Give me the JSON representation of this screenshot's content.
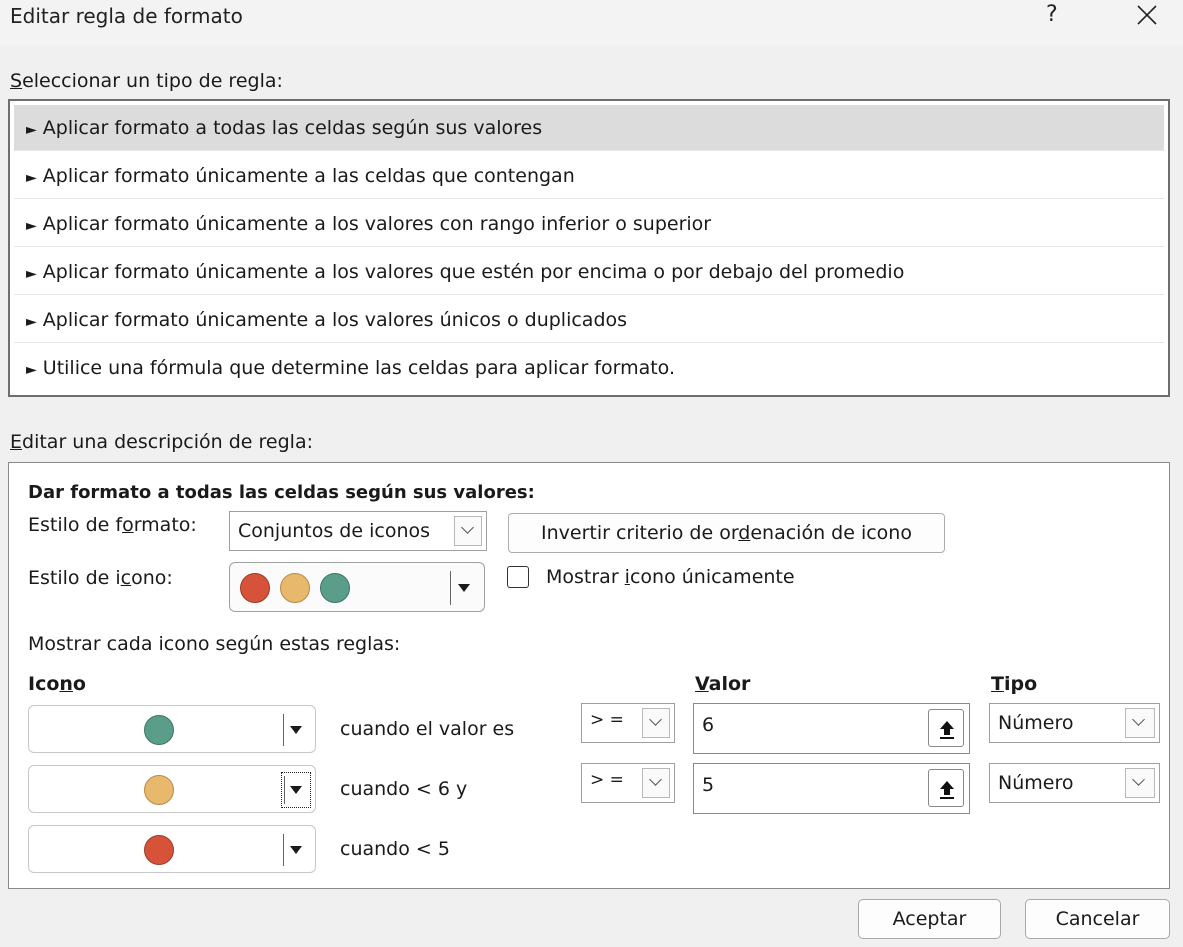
{
  "window": {
    "title": "Editar regla de formato",
    "help_label": "?"
  },
  "rule_type": {
    "label_accel": "S",
    "label_rest": "eleccionar un tipo de regla:",
    "items": [
      {
        "label": "Aplicar formato a todas las celdas según sus valores"
      },
      {
        "label": "Aplicar formato únicamente a las celdas que contengan"
      },
      {
        "label": "Aplicar formato únicamente a los valores con rango inferior o superior"
      },
      {
        "label": "Aplicar formato únicamente a los valores que estén por encima o por debajo del promedio"
      },
      {
        "label": "Aplicar formato únicamente a los valores únicos o duplicados"
      },
      {
        "label": "Utilice una fórmula que determine las celdas para aplicar formato."
      }
    ],
    "selected_index": 0,
    "arrow_glyph": "►"
  },
  "description": {
    "label_accel": "E",
    "label_rest": "ditar una descripción de regla:",
    "heading": "Dar formato a todas las celdas según sus valores:",
    "format_style": {
      "label_pre": "Estilo de f",
      "label_accel": "o",
      "label_post": "rmato:",
      "value": "Conjuntos de iconos"
    },
    "reverse_button": {
      "label_pre": "Invertir criterio de or",
      "label_accel": "d",
      "label_post": "enación de icono"
    },
    "icon_style": {
      "label_pre": "Estilo de i",
      "label_accel": "c",
      "label_post": "ono:",
      "icons": [
        "red-circle-icon",
        "yellow-circle-icon",
        "green-circle-icon"
      ]
    },
    "show_icon_only": {
      "label_pre": "Mostrar ",
      "label_accel": "i",
      "label_post": "cono únicamente",
      "checked": false
    },
    "rules_caption": "Mostrar cada icono según estas reglas:",
    "columns": {
      "icon_pre": "Ico",
      "icon_accel": "n",
      "icon_post": "o",
      "value_accel": "V",
      "value_rest": "alor",
      "type_accel": "T",
      "type_rest": "ipo"
    },
    "rows": [
      {
        "icon": "green-circle-icon",
        "condition": "cuando el valor es",
        "operator": "> =",
        "value": "6",
        "type": "Número"
      },
      {
        "icon": "yellow-circle-icon",
        "condition": "cuando < 6 y",
        "operator": "> =",
        "value": "5",
        "type": "Número"
      },
      {
        "icon": "red-circle-icon",
        "condition": "cuando < 5"
      }
    ]
  },
  "footer": {
    "ok": "Aceptar",
    "cancel": "Cancelar"
  },
  "colors": {
    "green": "#5a9e8a",
    "yellow": "#e8b86d",
    "red": "#d6533a",
    "selected_row": "#dcdcdc"
  }
}
